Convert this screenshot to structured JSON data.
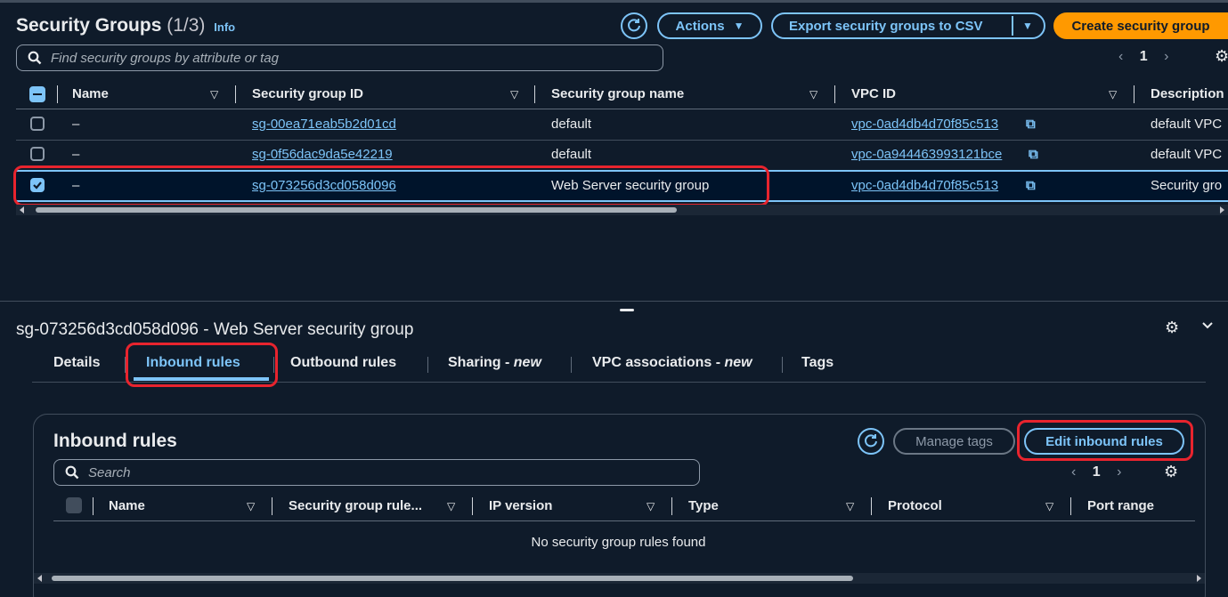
{
  "header": {
    "title": "Security Groups",
    "count": "(1/3)",
    "info": "Info",
    "actions_label": "Actions",
    "export_label": "Export security groups to CSV",
    "create_label": "Create security group",
    "search_placeholder": "Find security groups by attribute or tag",
    "page": "1"
  },
  "table": {
    "columns": [
      "Name",
      "Security group ID",
      "Security group name",
      "VPC ID",
      "Description"
    ],
    "rows": [
      {
        "name": "–",
        "id": "sg-00ea71eab5b2d01cd",
        "group_name": "default",
        "vpc": "vpc-0ad4db4d70f85c513",
        "desc": "default VPC",
        "checked": false
      },
      {
        "name": "–",
        "id": "sg-0f56dac9da5e42219",
        "group_name": "default",
        "vpc": "vpc-0a944463993121bce",
        "desc": "default VPC",
        "checked": false
      },
      {
        "name": "–",
        "id": "sg-073256d3cd058d096",
        "group_name": "Web Server security group",
        "vpc": "vpc-0ad4db4d70f85c513",
        "desc": "Security gro",
        "checked": true
      }
    ]
  },
  "detail": {
    "title": "sg-073256d3cd058d096 - Web Server security group",
    "tabs": [
      {
        "label": "Details",
        "suffix": ""
      },
      {
        "label": "Inbound rules",
        "suffix": ""
      },
      {
        "label": "Outbound rules",
        "suffix": ""
      },
      {
        "label": "Sharing - ",
        "suffix": "new"
      },
      {
        "label": "VPC associations - ",
        "suffix": "new"
      },
      {
        "label": "Tags",
        "suffix": ""
      }
    ]
  },
  "inbound": {
    "title": "Inbound rules",
    "manage_tags": "Manage tags",
    "edit_label": "Edit inbound rules",
    "search_placeholder": "Search",
    "page": "1",
    "columns": [
      "Name",
      "Security group rule...",
      "IP version",
      "Type",
      "Protocol",
      "Port range"
    ],
    "empty": "No security group rules found"
  },
  "colors": {
    "accent": "#7dc4f8",
    "primary": "#ff9900",
    "background": "#0f1b2a",
    "selected_row": "#00142b",
    "highlight": "#e8242e"
  }
}
